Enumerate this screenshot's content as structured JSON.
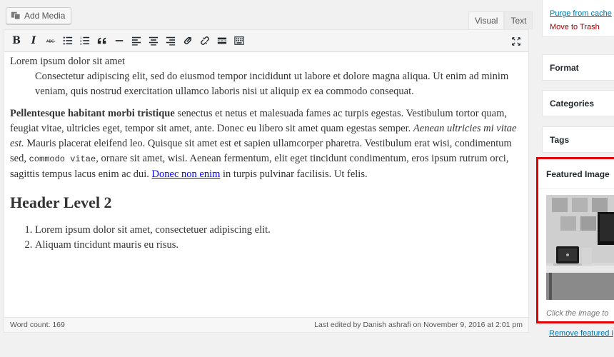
{
  "media": {
    "add_media_label": "Add Media"
  },
  "editor_tabs": {
    "visual": "Visual",
    "text": "Text"
  },
  "content": {
    "line1": "Lorem ipsum dolor sit amet",
    "quote": "Consectetur adipiscing elit, sed do eiusmod tempor incididunt ut labore et dolore magna aliqua. Ut enim ad minim veniam, quis nostrud exercitation ullamco laboris nisi ut aliquip ex ea commodo consequat.",
    "para_bold": "Pellentesque habitant morbi tristique",
    "para_a": " senectus et netus et malesuada fames ac turpis egestas. Vestibulum tortor quam, feugiat vitae, ultricies eget, tempor sit amet, ante. Donec eu libero sit amet quam egestas semper. ",
    "para_italic": "Aenean ultricies mi vitae est.",
    "para_b": " Mauris placerat eleifend leo. Quisque sit amet est et sapien ullamcorper pharetra. Vestibulum erat wisi, condimentum sed, ",
    "para_code": "commodo vitae",
    "para_c": ", ornare sit amet, wisi. Aenean fermentum, elit eget tincidunt condimentum, eros ipsum rutrum orci, sagittis tempus lacus enim ac dui. ",
    "para_link": "Donec non enim",
    "para_d": " in turpis pulvinar facilisis. Ut felis.",
    "heading": "Header Level 2",
    "list": [
      "Lorem ipsum dolor sit amet, consectetuer adipiscing elit.",
      "Aliquam tincidunt mauris eu risus."
    ]
  },
  "status": {
    "word_count": "Word count: 169",
    "last_edited": "Last edited by Danish ashrafi on November 9, 2016 at 2:01 pm"
  },
  "sidebar": {
    "purge": "Purge from cache",
    "trash": "Move to Trash",
    "format": "Format",
    "categories": "Categories",
    "tags": "Tags",
    "featured_image": "Featured Image",
    "hint": "Click the image to",
    "remove": "Remove featured i"
  },
  "colors": {
    "link": "#0073aa",
    "trash": "#a00",
    "highlight_border": "#e20000"
  }
}
